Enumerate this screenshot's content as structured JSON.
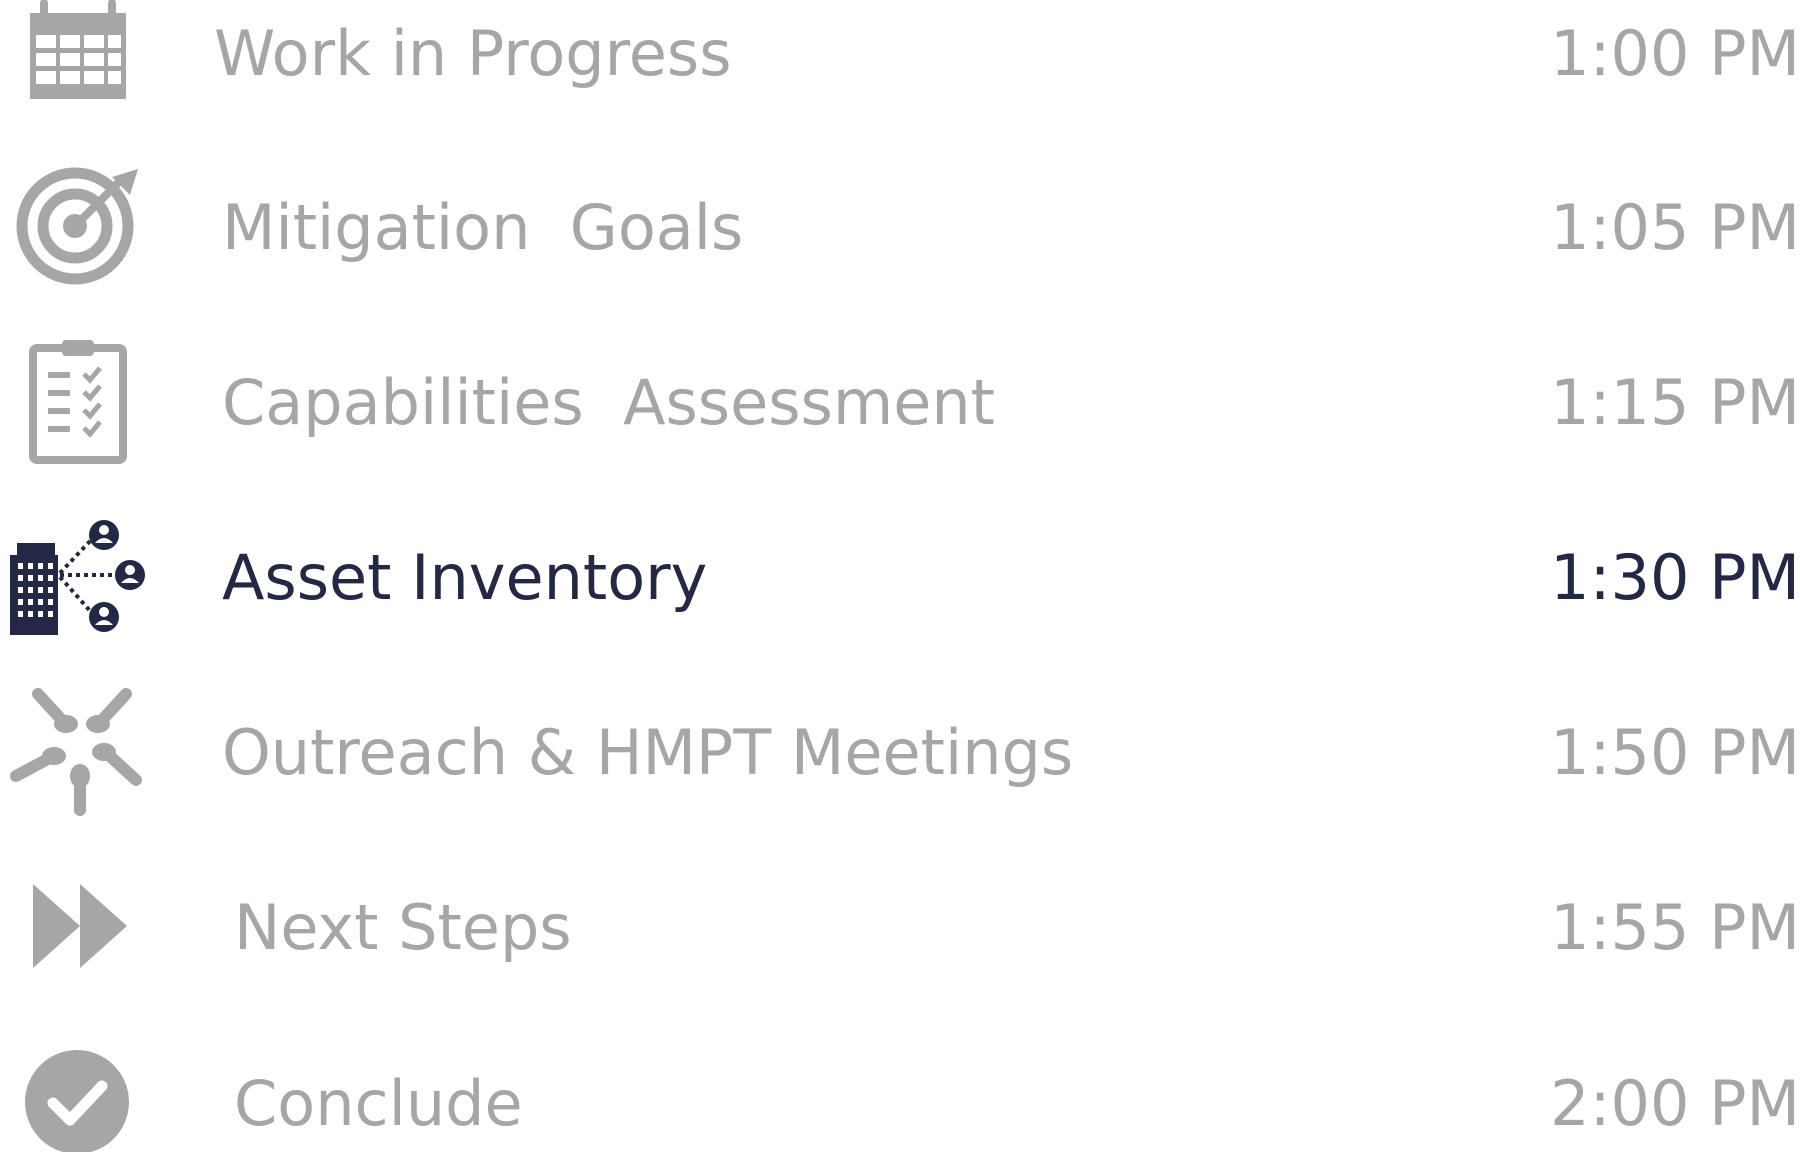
{
  "colors": {
    "muted": "#a6a6a6",
    "active": "#232845",
    "background": "#ffffff"
  },
  "agenda": {
    "items": [
      {
        "label": "Work in Progress",
        "time": "1:00 PM",
        "icon": "calendar-icon",
        "active": false
      },
      {
        "label": "Mitigation  Goals",
        "time": "1:05 PM",
        "icon": "target-icon",
        "active": false
      },
      {
        "label": "Capabilities  Assessment",
        "time": "1:15 PM",
        "icon": "clipboard-checklist-icon",
        "active": false
      },
      {
        "label": "Asset Inventory",
        "time": "1:30 PM",
        "icon": "building-network-icon",
        "active": true
      },
      {
        "label": "Outreach & HMPT Meetings",
        "time": "1:50 PM",
        "icon": "hands-circle-icon",
        "active": false
      },
      {
        "label": "Next Steps",
        "time": "1:55 PM",
        "icon": "fast-forward-icon",
        "active": false
      },
      {
        "label": "Conclude",
        "time": "2:00 PM",
        "icon": "check-circle-icon",
        "active": false
      }
    ]
  }
}
